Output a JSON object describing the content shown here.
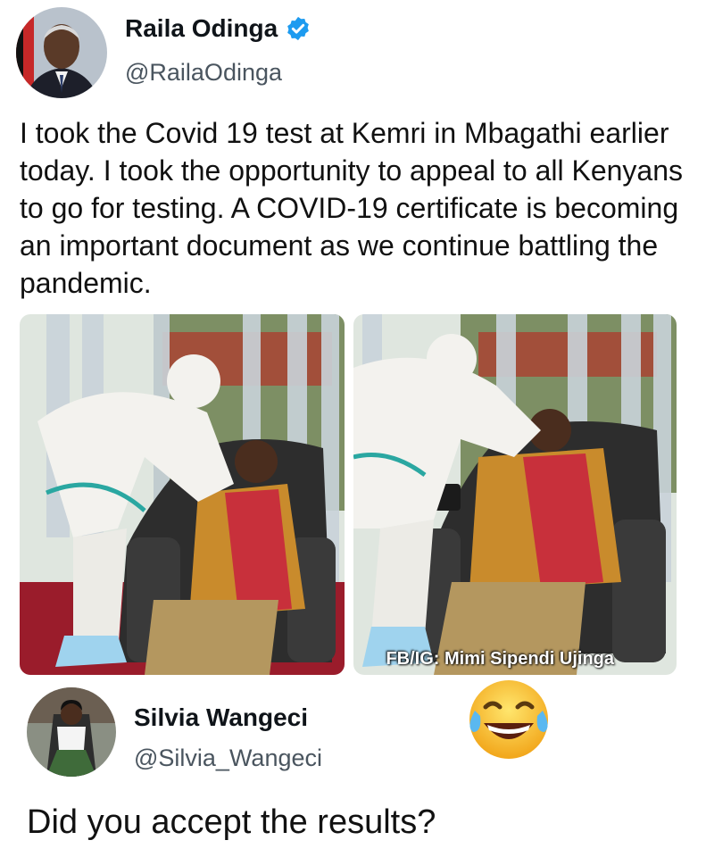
{
  "tweet": {
    "display_name": "Raila Odinga",
    "handle": "@RailaOdinga",
    "avatar_icon": "profile-photo",
    "verified_icon": "verified-badge-icon",
    "verified_color": "#1d9bf0",
    "text": "I took the Covid 19 test at Kemri in Mbagathi earlier today. I took the opportunity to appeal to all Kenyans to go for testing. A COVID-19 certificate is becoming an important document as we continue battling the pandemic.",
    "media": {
      "count": 2,
      "watermark": "FB/IG: Mimi Sipendi Ujinga"
    }
  },
  "reply": {
    "display_name": "Silvia Wangeci",
    "handle": "@Silvia_Wangeci",
    "avatar_icon": "profile-photo",
    "emoji_icon": "tears-of-joy-emoji-icon",
    "text": "Did you accept the results?"
  }
}
